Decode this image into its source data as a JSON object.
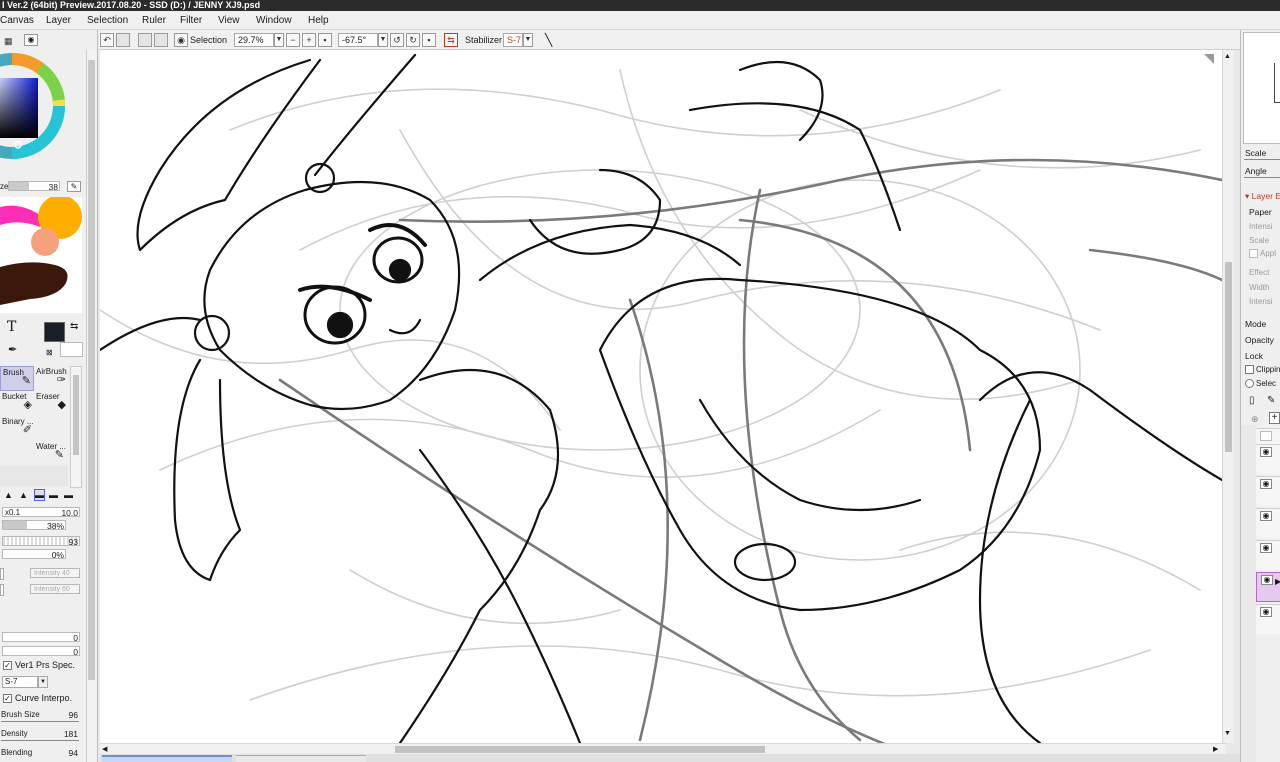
{
  "window": {
    "title": "I Ver.2 (64bit) Preview.2017.08.20 - SSD (D:) / JENNY XJ9.psd"
  },
  "menu": [
    "Canvas",
    "Layer",
    "Selection",
    "Ruler",
    "Filter",
    "View",
    "Window",
    "Help"
  ],
  "toolbar": {
    "selection_label": "Selection",
    "zoom": "29.7%",
    "angle": "-67.5°",
    "stabilizer_label": "Stabilizer",
    "stabilizer_value": "S-7"
  },
  "left_panel": {
    "size_label": "ze",
    "size_value": "38",
    "tools": [
      {
        "label": "Brush"
      },
      {
        "label": "AirBrush"
      },
      {
        "label": "Bucket"
      },
      {
        "label": "Eraser"
      },
      {
        "label": "Binary ..."
      },
      {
        "label": "Water ..."
      }
    ],
    "min_size": {
      "label": "x0.1",
      "value": "10.0"
    },
    "density_pct": "38%",
    "density_fraction": 0.38,
    "param_value": "93",
    "param2_value": "0%",
    "intensity1_label": "Intensity 40",
    "intensity2_label": "Intensity 60",
    "value_a": "0",
    "value_b": "0",
    "ver1_label": "Ver1 Prs Spec.",
    "stabilizer_select": "S-7",
    "curve_label": "Curve Interpo.",
    "brush_size_label": "Brush Size",
    "brush_size_value": "96",
    "density_label": "Density",
    "density_value": "181",
    "blending_label": "Blending",
    "blending_value": "94"
  },
  "right_panel": {
    "scale_label": "Scale",
    "angle_label": "Angle",
    "layer_effect_label": "Layer E",
    "paper_label": "Paper",
    "intensity_label": "Intensi",
    "scale2_label": "Scale",
    "apply_label": "Appl",
    "effect_label": "Effect",
    "width_label": "Width",
    "intensity2_label": "Intensi",
    "mode_label": "Mode",
    "opacity_label": "Opacity",
    "lock_label": "Lock",
    "clipping_label": "Clippin",
    "selection_label": "Selec"
  },
  "colors": {
    "current_color": "#1a1e28",
    "titlebar": "#2b2b2b",
    "stabilizer_value_color": "#c0392b",
    "selected_layer": "#e6c8ee"
  }
}
